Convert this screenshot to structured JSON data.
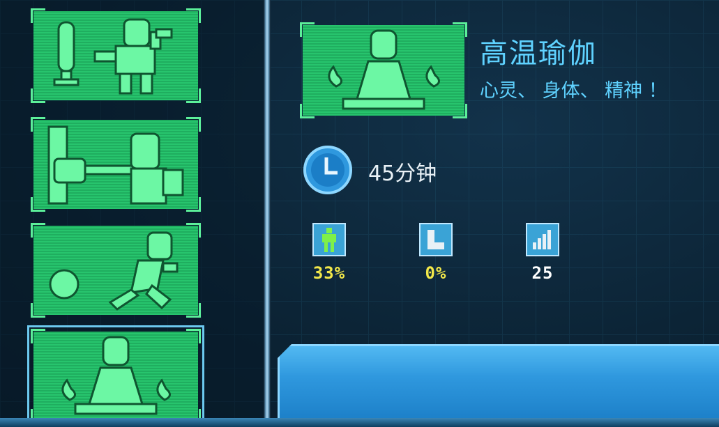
{
  "workouts": [
    {
      "name": "boxing-dumbbell-workout"
    },
    {
      "name": "punch-bag-workout"
    },
    {
      "name": "running-workout"
    },
    {
      "name": "hot-yoga-workout",
      "selected": true
    }
  ],
  "detail": {
    "title": "高温瑜伽",
    "subtitle": "心灵、 身体、 精神 ！",
    "duration": "45分钟"
  },
  "stats": [
    {
      "icon": "body-icon",
      "value": "33%",
      "color": "#f2e84a"
    },
    {
      "icon": "boot-icon",
      "value": "0%",
      "color": "#f2e84a"
    },
    {
      "icon": "level-bars-icon",
      "value": "25",
      "color": "#ffffff"
    }
  ],
  "colors": {
    "accent": "#5fd2ff",
    "card_green": "#27c46d",
    "pixel_art": "#6cf7a4",
    "button_blue": "#2f98de"
  }
}
